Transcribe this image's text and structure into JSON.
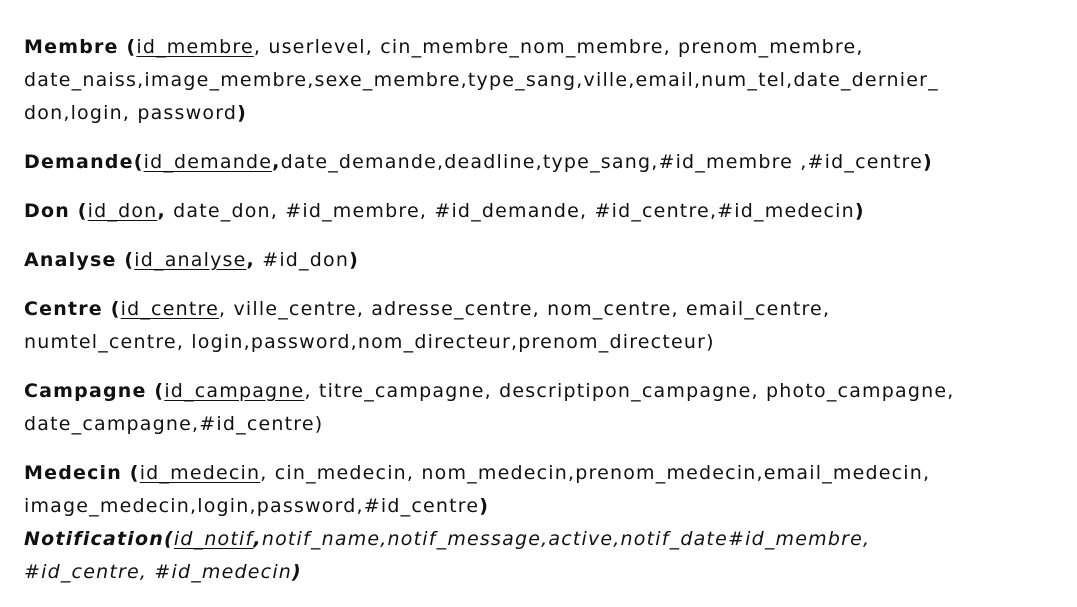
{
  "schema": {
    "membre": {
      "name": "Membre",
      "open": " (",
      "pk": "id_membre",
      "line1_rest": ", userlevel, cin_membre_nom_membre, prenom_membre,",
      "line2": "date_naiss,image_membre,sexe_membre,type_sang,ville,email,num_tel,date_dernier_",
      "line3": "don,login, password",
      "close": ")"
    },
    "demande": {
      "name": "Demande",
      "open": "(",
      "pk": "id_demande",
      "comma": ",",
      "rest": "date_demande,deadline,type_sang,#id_membre ,#id_centre",
      "close": ")"
    },
    "don": {
      "name": "Don",
      "open": " (",
      "pk": "id_don",
      "comma": ",",
      "rest": " date_don, #id_membre, #id_demande, #id_centre,#id_medecin",
      "close": ")"
    },
    "analyse": {
      "name": "Analyse",
      "open": " (",
      "pk": "id_analyse",
      "comma": ",",
      "rest": " #id_don",
      "close": ")"
    },
    "centre": {
      "name": "Centre",
      "open": " (",
      "pk": "id_centre",
      "line1_rest": ", ville_centre, adresse_centre, nom_centre, email_centre,",
      "line2": "numtel_centre, login,password,nom_directeur,prenom_directeur)"
    },
    "campagne": {
      "name": "Campagne",
      "open": " (",
      "pk": "id_campagne",
      "line1_rest": ", titre_campagne, descriptipon_campagne, photo_campagne,",
      "line2": "date_campagne,#id_centre)"
    },
    "medecin": {
      "name": "Medecin",
      "open": " (",
      "pk": "id_medecin",
      "line1_rest": ", cin_medecin, nom_medecin,prenom_medecin,email_medecin,",
      "line2": "image_medecin,login,password,#id_centre",
      "close": ")"
    },
    "notification": {
      "name_open": "Notification(",
      "pk": "id_notif",
      "comma": ",",
      "line1_rest": "notif_name,notif_message,active,notif_date#id_membre,",
      "line2": "#id_centre, #id_medecin",
      "close": ")"
    }
  }
}
